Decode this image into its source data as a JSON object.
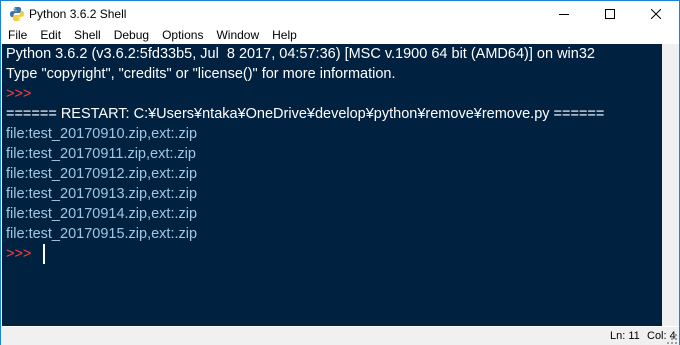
{
  "window": {
    "title": "Python 3.6.2 Shell"
  },
  "menu": {
    "items": [
      "File",
      "Edit",
      "Shell",
      "Debug",
      "Options",
      "Window",
      "Help"
    ]
  },
  "shell": {
    "banner": "Python 3.6.2 (v3.6.2:5fd33b5, Jul  8 2017, 04:57:36) [MSC v.1900 64 bit (AMD64)] on win32",
    "info": "Type \"copyright\", \"credits\" or \"license()\" for more information.",
    "prompt": ">>>",
    "restart": "====== RESTART: C:¥Users¥ntaka¥OneDrive¥develop¥python¥remove¥remove.py ======",
    "output": [
      "file:test_20170910.zip,ext:.zip",
      "file:test_20170911.zip,ext:.zip",
      "file:test_20170912.zip,ext:.zip",
      "file:test_20170913.zip,ext:.zip",
      "file:test_20170914.zip,ext:.zip",
      "file:test_20170915.zip,ext:.zip"
    ],
    "final_prompt": ">>>"
  },
  "status": {
    "line": "Ln: 11",
    "col": "Col: 4"
  },
  "colors": {
    "editor_bg": "#002240",
    "prompt": "#ff4040",
    "stdout": "#9ec8e6",
    "text": "#ffffff"
  }
}
